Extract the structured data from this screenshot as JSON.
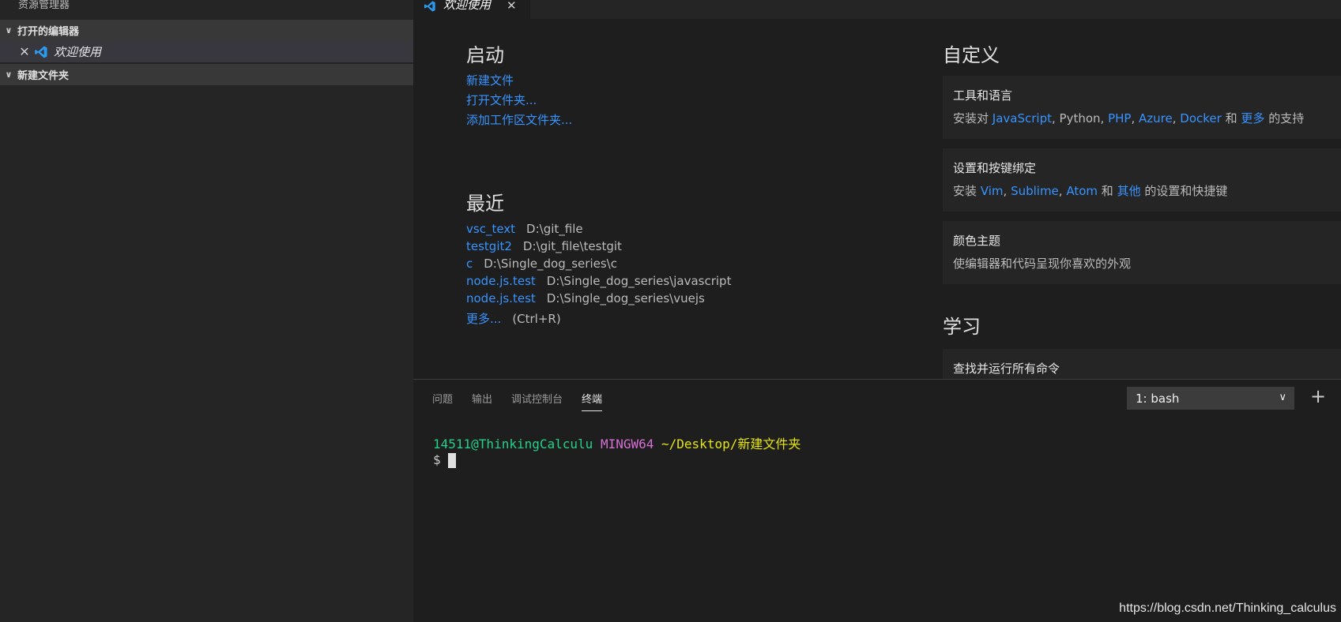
{
  "sidebar": {
    "title": "资源管理器",
    "open_editors_header": "打开的编辑器",
    "open_editor_item": "欢迎使用",
    "folder_header": "新建文件夹"
  },
  "tabs": {
    "welcome": "欢迎使用"
  },
  "welcome": {
    "start": {
      "heading": "启动",
      "new_file": "新建文件",
      "open_folder": "打开文件夹...",
      "add_workspace": "添加工作区文件夹..."
    },
    "recent": {
      "heading": "最近",
      "items": [
        {
          "name": "vsc_text",
          "path": "D:\\git_file"
        },
        {
          "name": "testgit2",
          "path": "D:\\git_file\\testgit"
        },
        {
          "name": "c",
          "path": "D:\\Single_dog_series\\c"
        },
        {
          "name": "node.js.test",
          "path": "D:\\Single_dog_series\\javascript"
        },
        {
          "name": "node.js.test",
          "path": "D:\\Single_dog_series\\vuejs"
        }
      ],
      "more": "更多...",
      "more_shortcut": "(Ctrl+R)"
    },
    "customize": {
      "heading": "自定义",
      "tools": {
        "title": "工具和语言",
        "prefix": "安装对",
        "js": "JavaScript",
        "python": ", Python,",
        "php": "PHP",
        "azure": "Azure",
        "docker": "Docker",
        "and": "和",
        "more": "更多",
        "suffix": "的支持"
      },
      "keys": {
        "title": "设置和按键绑定",
        "prefix": "安装",
        "vim": "Vim",
        "sublime": "Sublime",
        "atom": "Atom",
        "and": "和",
        "other": "其他",
        "suffix": "的设置和快捷键"
      },
      "theme": {
        "title": "颜色主题",
        "desc": "使编辑器和代码呈现你喜欢的外观"
      }
    },
    "learn": {
      "heading": "学习",
      "commands_title": "查找并运行所有命令"
    }
  },
  "panel": {
    "tabs": [
      "问题",
      "输出",
      "调试控制台",
      "终端"
    ],
    "active_tab": "终端",
    "terminal_select": "1: bash",
    "prompt_user": "14511@ThinkingCalculu",
    "prompt_env": "MINGW64",
    "prompt_path": "~/Desktop/新建文件夹",
    "prompt_symbol": "$"
  },
  "watermark": "https://blog.csdn.net/Thinking_calculus",
  "colors": {
    "link": "#3794ff",
    "background": "#1e1e1e",
    "sidebar": "#252526"
  }
}
